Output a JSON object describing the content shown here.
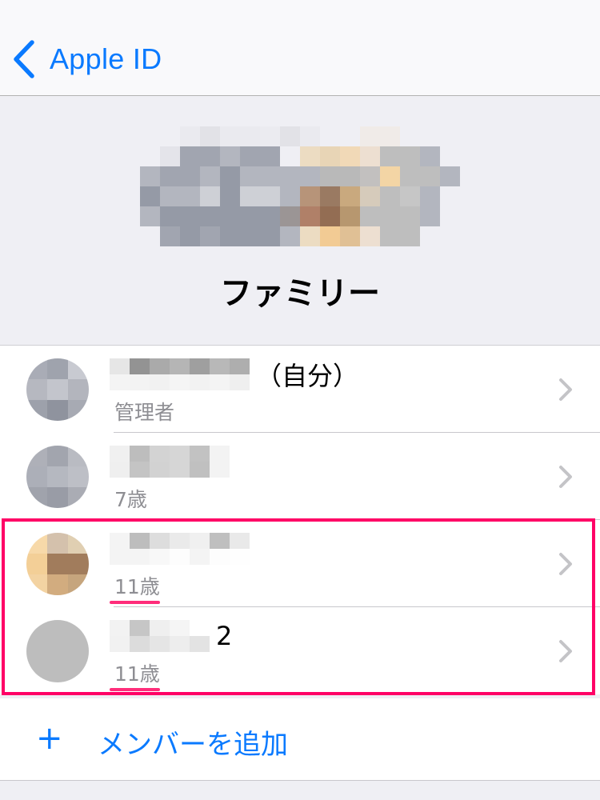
{
  "navbar": {
    "back_label": "Apple ID",
    "back_icon": "chevron-left-icon"
  },
  "header": {
    "group_image": "pixelated-group-photo",
    "title": "ファミリー"
  },
  "members": [
    {
      "name_visible_suffix": "（自分）",
      "name_obscured": true,
      "subtitle": "管理者",
      "avatar": "pixelated-photo-gray",
      "highlighted": false
    },
    {
      "name_visible_suffix": "",
      "name_obscured": true,
      "subtitle": "7歳",
      "avatar": "pixelated-photo-gray",
      "highlighted": false
    },
    {
      "name_visible_suffix": "",
      "name_obscured": true,
      "subtitle": "11歳",
      "avatar": "pixelated-photo-tan",
      "highlighted": true
    },
    {
      "name_visible_suffix": "2",
      "name_obscured": true,
      "subtitle": "11歳",
      "avatar": "plain-gray-placeholder",
      "highlighted": true
    }
  ],
  "add_member": {
    "icon": "plus-icon",
    "plus_glyph": "+",
    "label": "メンバーを追加"
  },
  "colors": {
    "accent": "#0a7aff",
    "highlight_box": "#ff0066",
    "underline": "#ff2d7a",
    "secondary_text": "#8e8e93",
    "background": "#efeff4"
  }
}
